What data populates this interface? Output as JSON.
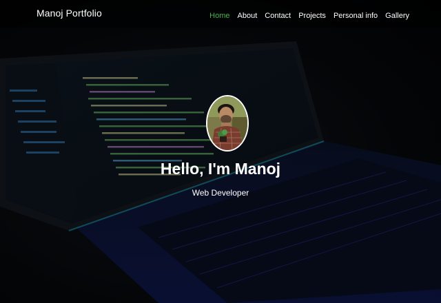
{
  "navbar": {
    "brand": "Manoj Portfolio",
    "links": [
      {
        "label": "Home",
        "active": true
      },
      {
        "label": "About"
      },
      {
        "label": "Contact"
      },
      {
        "label": "Projects"
      },
      {
        "label": "Personal info"
      },
      {
        "label": "Gallery"
      }
    ]
  },
  "hero": {
    "title": "Hello, I'm Manoj",
    "subtitle": "Web Developer",
    "background": "laptop-code-photo",
    "avatar": "profile-photo"
  },
  "colors": {
    "active_link": "#4caf50",
    "text": "#ffffff",
    "background": "#050608"
  }
}
